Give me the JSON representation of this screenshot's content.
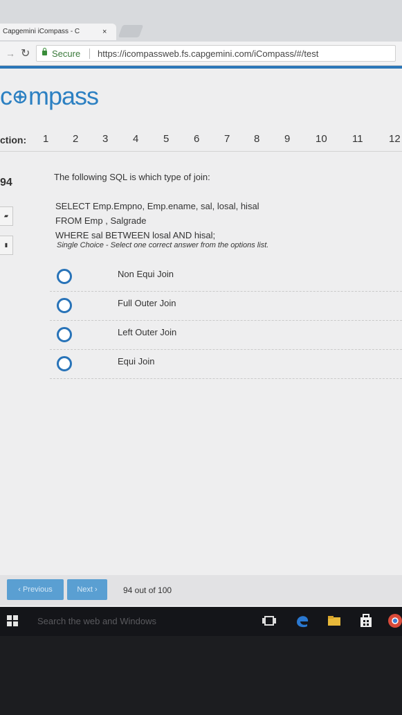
{
  "browser": {
    "tab_title": "Capgemini iCompass - C",
    "tab_close": "×",
    "secure_label": "Secure",
    "url": "https://icompassweb.fs.capgemini.com/iCompass/#/test"
  },
  "logo": {
    "prefix": "c",
    "suffix": "mpass"
  },
  "question_nav": {
    "label": "ction:",
    "numbers": [
      "1",
      "2",
      "3",
      "4",
      "5",
      "6",
      "7",
      "8",
      "9",
      "10",
      "11",
      "12"
    ]
  },
  "question": {
    "number": "94",
    "text": "The following SQL is which type of join:",
    "sql_lines": [
      "SELECT Emp.Empno, Emp.ename, sal, losal, hisal",
      "FROM Emp , Salgrade",
      "WHERE  sal BETWEEN losal AND hisal;"
    ],
    "hint": "Single Choice - Select one correct answer from the options list."
  },
  "options": [
    "Non Equi Join",
    "Full Outer Join",
    "Left Outer Join",
    "Equi Join"
  ],
  "footer": {
    "previous_label": "‹ Previous",
    "next_label": "Next ›",
    "progress_text": "94 out of 100"
  },
  "taskbar": {
    "search_placeholder": "Search the web and Windows"
  },
  "colors": {
    "accent": "#2c80c2",
    "radio": "#2873b8",
    "button": "#5a9fd2"
  }
}
